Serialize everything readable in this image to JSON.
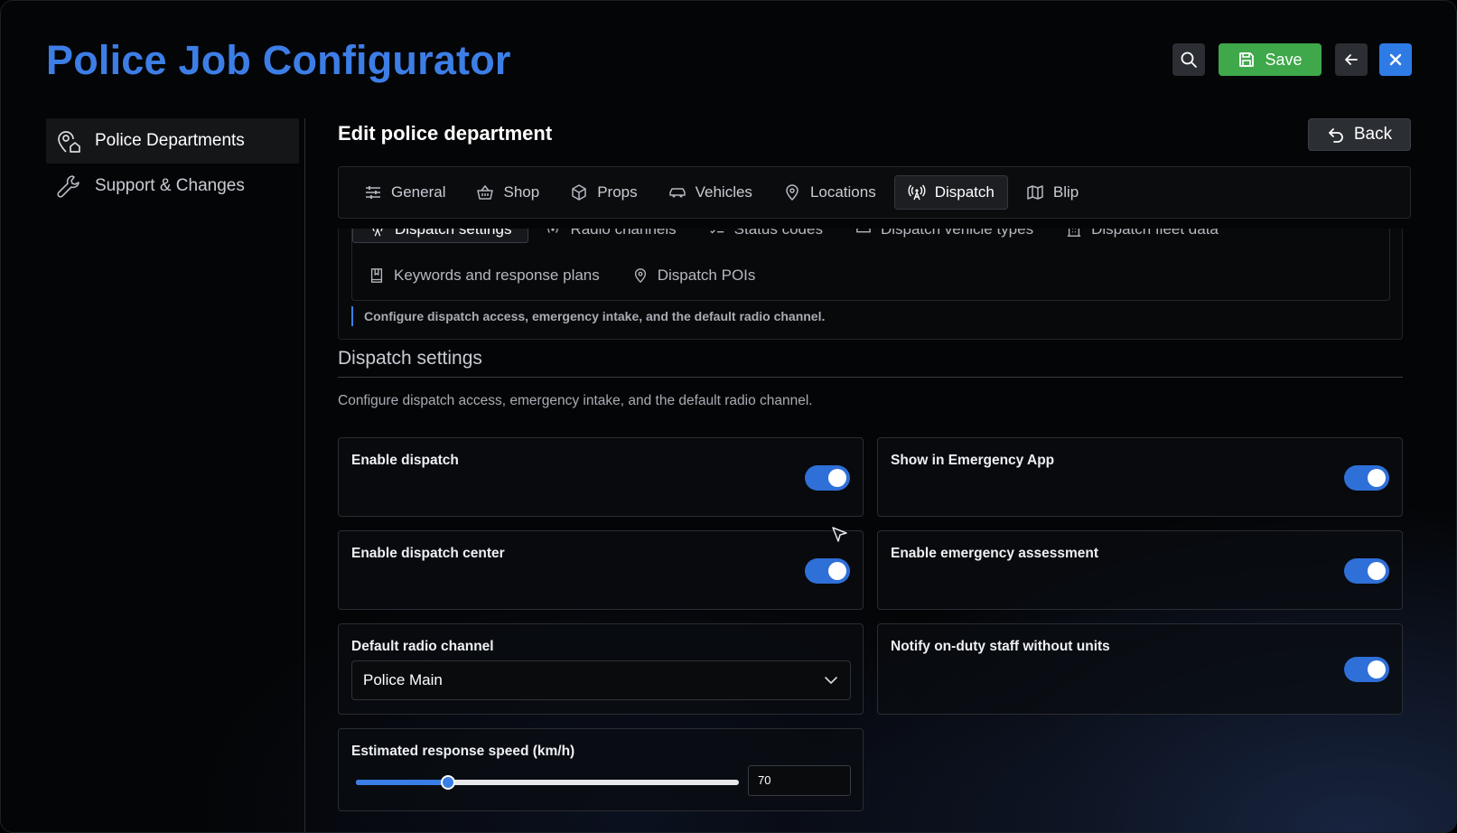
{
  "header": {
    "title": "Police Job Configurator",
    "save_label": "Save",
    "icons": [
      "search-icon",
      "save-icon",
      "arrow-left-icon",
      "close-icon"
    ],
    "colors": {
      "title": "#3d7ee6",
      "save": "#3fa84a",
      "close": "#2f7be6",
      "accent": "#2f6fd8"
    }
  },
  "sidebar": {
    "items": [
      {
        "label": "Police Departments",
        "icon": "map-pin-home-icon",
        "active": true
      },
      {
        "label": "Support & Changes",
        "icon": "wrench-icon",
        "active": false
      }
    ]
  },
  "main": {
    "title": "Edit police department",
    "back_label": "Back",
    "tabs": [
      {
        "label": "General",
        "icon": "sliders-icon"
      },
      {
        "label": "Shop",
        "icon": "basket-icon"
      },
      {
        "label": "Props",
        "icon": "box-icon"
      },
      {
        "label": "Vehicles",
        "icon": "car-icon"
      },
      {
        "label": "Locations",
        "icon": "map-pin-icon"
      },
      {
        "label": "Dispatch",
        "icon": "antenna-icon",
        "active": true
      },
      {
        "label": "Blip",
        "icon": "map-icon"
      }
    ],
    "subtabs": [
      {
        "label": "Dispatch settings",
        "icon": "antenna-icon",
        "active": true
      },
      {
        "label": "Radio channels",
        "icon": "radio-icon"
      },
      {
        "label": "Status codes",
        "icon": "list-check-icon"
      },
      {
        "label": "Dispatch vehicle types",
        "icon": "car-icon"
      },
      {
        "label": "Dispatch fleet data",
        "icon": "building-icon"
      },
      {
        "label": "Keywords and response plans",
        "icon": "book-icon"
      },
      {
        "label": "Dispatch POIs",
        "icon": "map-pin-icon"
      }
    ],
    "subtab_description": "Configure dispatch access, emergency intake, and the default radio channel.",
    "section": {
      "title": "Dispatch settings",
      "description": "Configure dispatch access, emergency intake, and the default radio channel."
    },
    "settings": {
      "enable_dispatch": {
        "label": "Enable dispatch",
        "on": true
      },
      "show_in_emergency_app": {
        "label": "Show in Emergency App",
        "on": true
      },
      "enable_dispatch_center": {
        "label": "Enable dispatch center",
        "on": true
      },
      "enable_emergency_assessment": {
        "label": "Enable emergency assessment",
        "on": true
      },
      "default_radio_channel": {
        "label": "Default radio channel",
        "value": "Police Main"
      },
      "notify_onduty": {
        "label": "Notify on-duty staff without units",
        "on": true
      },
      "response_speed": {
        "label": "Estimated response speed (km/h)",
        "value": "70",
        "slider_fraction": 0.24
      }
    }
  }
}
